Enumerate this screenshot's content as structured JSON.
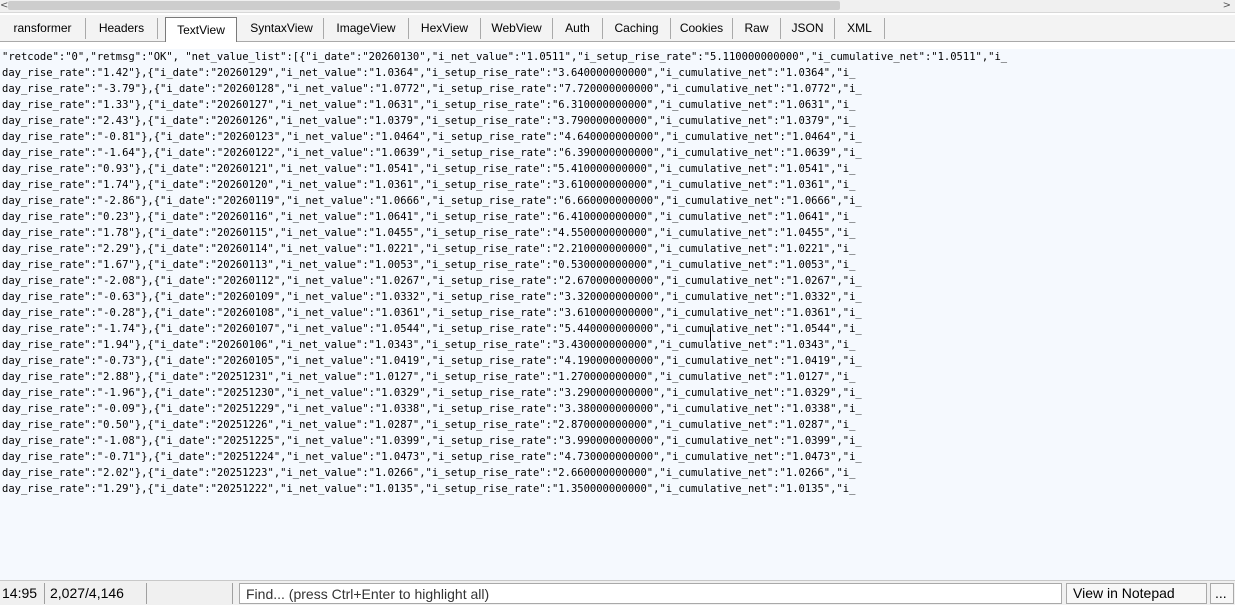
{
  "scrollbar": {
    "left_arrow": "<",
    "right_arrow": ">"
  },
  "tabs": [
    {
      "label": "ransformer"
    },
    {
      "label": "Headers"
    },
    {
      "label": "TextView",
      "active": true
    },
    {
      "label": "SyntaxView"
    },
    {
      "label": "ImageView"
    },
    {
      "label": "HexView"
    },
    {
      "label": "WebView"
    },
    {
      "label": "Auth"
    },
    {
      "label": "Caching"
    },
    {
      "label": "Cookies"
    },
    {
      "label": "Raw"
    },
    {
      "label": "JSON"
    },
    {
      "label": "XML"
    }
  ],
  "lines": [
    "\"retcode\":\"0\",\"retmsg\":\"OK\", \"net_value_list\":[{\"i_date\":\"20260130\",\"i_net_value\":\"1.0511\",\"i_setup_rise_rate\":\"5.110000000000\",\"i_cumulative_net\":\"1.0511\",\"i_",
    "day_rise_rate\":\"1.42\"},{\"i_date\":\"20260129\",\"i_net_value\":\"1.0364\",\"i_setup_rise_rate\":\"3.640000000000\",\"i_cumulative_net\":\"1.0364\",\"i_",
    "day_rise_rate\":\"-3.79\"},{\"i_date\":\"20260128\",\"i_net_value\":\"1.0772\",\"i_setup_rise_rate\":\"7.720000000000\",\"i_cumulative_net\":\"1.0772\",\"i_",
    "day_rise_rate\":\"1.33\"},{\"i_date\":\"20260127\",\"i_net_value\":\"1.0631\",\"i_setup_rise_rate\":\"6.310000000000\",\"i_cumulative_net\":\"1.0631\",\"i_",
    "day_rise_rate\":\"2.43\"},{\"i_date\":\"20260126\",\"i_net_value\":\"1.0379\",\"i_setup_rise_rate\":\"3.790000000000\",\"i_cumulative_net\":\"1.0379\",\"i_",
    "day_rise_rate\":\"-0.81\"},{\"i_date\":\"20260123\",\"i_net_value\":\"1.0464\",\"i_setup_rise_rate\":\"4.640000000000\",\"i_cumulative_net\":\"1.0464\",\"i_",
    "day_rise_rate\":\"-1.64\"},{\"i_date\":\"20260122\",\"i_net_value\":\"1.0639\",\"i_setup_rise_rate\":\"6.390000000000\",\"i_cumulative_net\":\"1.0639\",\"i_",
    "day_rise_rate\":\"0.93\"},{\"i_date\":\"20260121\",\"i_net_value\":\"1.0541\",\"i_setup_rise_rate\":\"5.410000000000\",\"i_cumulative_net\":\"1.0541\",\"i_",
    "day_rise_rate\":\"1.74\"},{\"i_date\":\"20260120\",\"i_net_value\":\"1.0361\",\"i_setup_rise_rate\":\"3.610000000000\",\"i_cumulative_net\":\"1.0361\",\"i_",
    "day_rise_rate\":\"-2.86\"},{\"i_date\":\"20260119\",\"i_net_value\":\"1.0666\",\"i_setup_rise_rate\":\"6.660000000000\",\"i_cumulative_net\":\"1.0666\",\"i_",
    "day_rise_rate\":\"0.23\"},{\"i_date\":\"20260116\",\"i_net_value\":\"1.0641\",\"i_setup_rise_rate\":\"6.410000000000\",\"i_cumulative_net\":\"1.0641\",\"i_",
    "day_rise_rate\":\"1.78\"},{\"i_date\":\"20260115\",\"i_net_value\":\"1.0455\",\"i_setup_rise_rate\":\"4.550000000000\",\"i_cumulative_net\":\"1.0455\",\"i_",
    "day_rise_rate\":\"2.29\"},{\"i_date\":\"20260114\",\"i_net_value\":\"1.0221\",\"i_setup_rise_rate\":\"2.210000000000\",\"i_cumulative_net\":\"1.0221\",\"i_",
    "day_rise_rate\":\"1.67\"},{\"i_date\":\"20260113\",\"i_net_value\":\"1.0053\",\"i_setup_rise_rate\":\"0.530000000000\",\"i_cumulative_net\":\"1.0053\",\"i_",
    "day_rise_rate\":\"-2.08\"},{\"i_date\":\"20260112\",\"i_net_value\":\"1.0267\",\"i_setup_rise_rate\":\"2.670000000000\",\"i_cumulative_net\":\"1.0267\",\"i_",
    "day_rise_rate\":\"-0.63\"},{\"i_date\":\"20260109\",\"i_net_value\":\"1.0332\",\"i_setup_rise_rate\":\"3.320000000000\",\"i_cumulative_net\":\"1.0332\",\"i_",
    "day_rise_rate\":\"-0.28\"},{\"i_date\":\"20260108\",\"i_net_value\":\"1.0361\",\"i_setup_rise_rate\":\"3.610000000000\",\"i_cumulative_net\":\"1.0361\",\"i_",
    "day_rise_rate\":\"-1.74\"},{\"i_date\":\"20260107\",\"i_net_value\":\"1.0544\",\"i_setup_rise_rate\":\"5.440000000000\",\"i_cumulative_net\":\"1.0544\",\"i_",
    "day_rise_rate\":\"1.94\"},{\"i_date\":\"20260106\",\"i_net_value\":\"1.0343\",\"i_setup_rise_rate\":\"3.430000000000\",\"i_cumulative_net\":\"1.0343\",\"i_",
    "day_rise_rate\":\"-0.73\"},{\"i_date\":\"20260105\",\"i_net_value\":\"1.0419\",\"i_setup_rise_rate\":\"4.190000000000\",\"i_cumulative_net\":\"1.0419\",\"i_",
    "day_rise_rate\":\"2.88\"},{\"i_date\":\"20251231\",\"i_net_value\":\"1.0127\",\"i_setup_rise_rate\":\"1.270000000000\",\"i_cumulative_net\":\"1.0127\",\"i_",
    "day_rise_rate\":\"-1.96\"},{\"i_date\":\"20251230\",\"i_net_value\":\"1.0329\",\"i_setup_rise_rate\":\"3.290000000000\",\"i_cumulative_net\":\"1.0329\",\"i_",
    "day_rise_rate\":\"-0.09\"},{\"i_date\":\"20251229\",\"i_net_value\":\"1.0338\",\"i_setup_rise_rate\":\"3.380000000000\",\"i_cumulative_net\":\"1.0338\",\"i_",
    "day_rise_rate\":\"0.50\"},{\"i_date\":\"20251226\",\"i_net_value\":\"1.0287\",\"i_setup_rise_rate\":\"2.870000000000\",\"i_cumulative_net\":\"1.0287\",\"i_",
    "day_rise_rate\":\"-1.08\"},{\"i_date\":\"20251225\",\"i_net_value\":\"1.0399\",\"i_setup_rise_rate\":\"3.990000000000\",\"i_cumulative_net\":\"1.0399\",\"i_",
    "day_rise_rate\":\"-0.71\"},{\"i_date\":\"20251224\",\"i_net_value\":\"1.0473\",\"i_setup_rise_rate\":\"4.730000000000\",\"i_cumulative_net\":\"1.0473\",\"i_",
    "day_rise_rate\":\"2.02\"},{\"i_date\":\"20251223\",\"i_net_value\":\"1.0266\",\"i_setup_rise_rate\":\"2.660000000000\",\"i_cumulative_net\":\"1.0266\",\"i_",
    "day_rise_rate\":\"1.29\"},{\"i_date\":\"20251222\",\"i_net_value\":\"1.0135\",\"i_setup_rise_rate\":\"1.350000000000\",\"i_cumulative_net\":\"1.0135\",\"i_"
  ],
  "status": {
    "cursor_position": "14:95",
    "char_count": "2,027/4,146",
    "find_placeholder": "Find... (press Ctrl+Enter to highlight all)",
    "view_in_notepad": "View in Notepad",
    "more": "..."
  },
  "colors": {
    "text_background": "#f5f9fe",
    "tab_strip": "#f3f3f3",
    "status_bar": "#f0f0f0"
  }
}
